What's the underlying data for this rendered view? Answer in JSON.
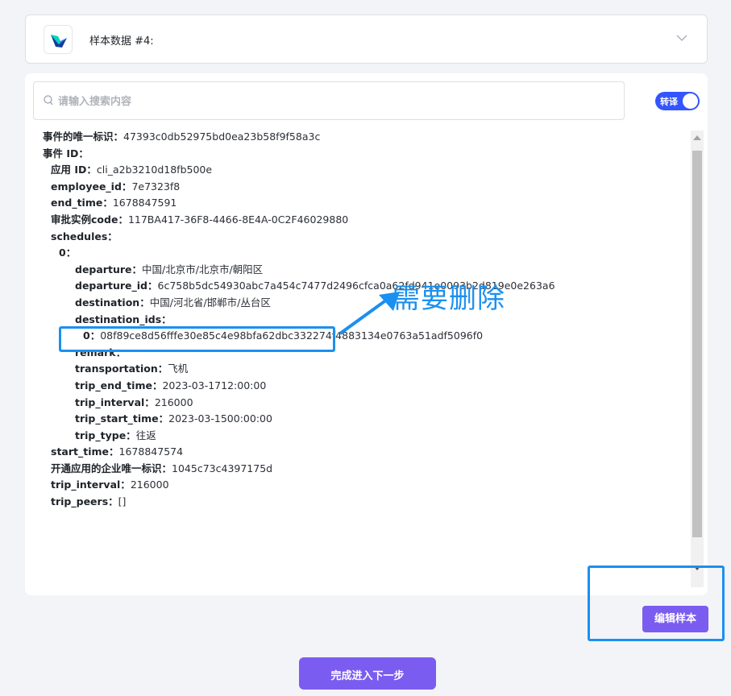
{
  "sample": {
    "title": "样本数据 #4:"
  },
  "search": {
    "placeholder": "请输入搜索内容"
  },
  "toggle": {
    "label": "转译",
    "on": true
  },
  "tree": [
    {
      "indent": 0,
      "key": "事件的唯一标识",
      "value": "47393c0db52975bd0ea23b58f9f58a3c"
    },
    {
      "indent": 0,
      "key": "事件 ID",
      "value": ""
    },
    {
      "indent": 1,
      "key": "应用 ID",
      "value": "cli_a2b3210d18fb500e"
    },
    {
      "indent": 1,
      "key": "employee_id",
      "value": "7e7323f8"
    },
    {
      "indent": 1,
      "key": "end_time",
      "value": "1678847591"
    },
    {
      "indent": 1,
      "key": "审批实例code",
      "value": "117BA417-36F8-4466-8E4A-0C2F46029880"
    },
    {
      "indent": 1,
      "key": "schedules",
      "value": ""
    },
    {
      "indent": 2,
      "key": "0",
      "value": ""
    },
    {
      "indent": 3,
      "key": "departure",
      "value": "中国/北京市/北京市/朝阳区"
    },
    {
      "indent": 3,
      "key": "departure_id",
      "value": "6c758b5dc54930abc7a454c7477d2496cfca0a62fd941e0093b2d819e0e263a6"
    },
    {
      "indent": 3,
      "key": "destination",
      "value": "中国/河北省/邯郸市/丛台区"
    },
    {
      "indent": 3,
      "key": "destination_ids",
      "value": ""
    },
    {
      "indent": 4,
      "key": "0",
      "value": "08f89ce8d56fffe30e85c4e98bfa62dbc332274f4883134e0763a51adf5096f0"
    },
    {
      "indent": 3,
      "key": "remark",
      "value": ""
    },
    {
      "indent": 3,
      "key": "transportation",
      "value": "飞机"
    },
    {
      "indent": 3,
      "key": "trip_end_time",
      "value": "2023-03-1712:00:00"
    },
    {
      "indent": 3,
      "key": "trip_interval",
      "value": "216000"
    },
    {
      "indent": 3,
      "key": "trip_start_time",
      "value": "2023-03-1500:00:00"
    },
    {
      "indent": 3,
      "key": "trip_type",
      "value": "往返"
    },
    {
      "indent": 1,
      "key": "start_time",
      "value": "1678847574"
    },
    {
      "indent": 1,
      "key": "开通应用的企业唯一标识",
      "value": "1045c73c4397175d"
    },
    {
      "indent": 1,
      "key": "trip_interval",
      "value": "216000"
    },
    {
      "indent": 1,
      "key": "trip_peers",
      "value": "[]"
    }
  ],
  "buttons": {
    "edit_sample": "编辑样本",
    "next_step": "完成进入下一步"
  },
  "annotation": {
    "text": "需要删除"
  },
  "colors": {
    "accent": "#7b5cf0",
    "toggle": "#3355ff",
    "annotation": "#1a90f0"
  }
}
